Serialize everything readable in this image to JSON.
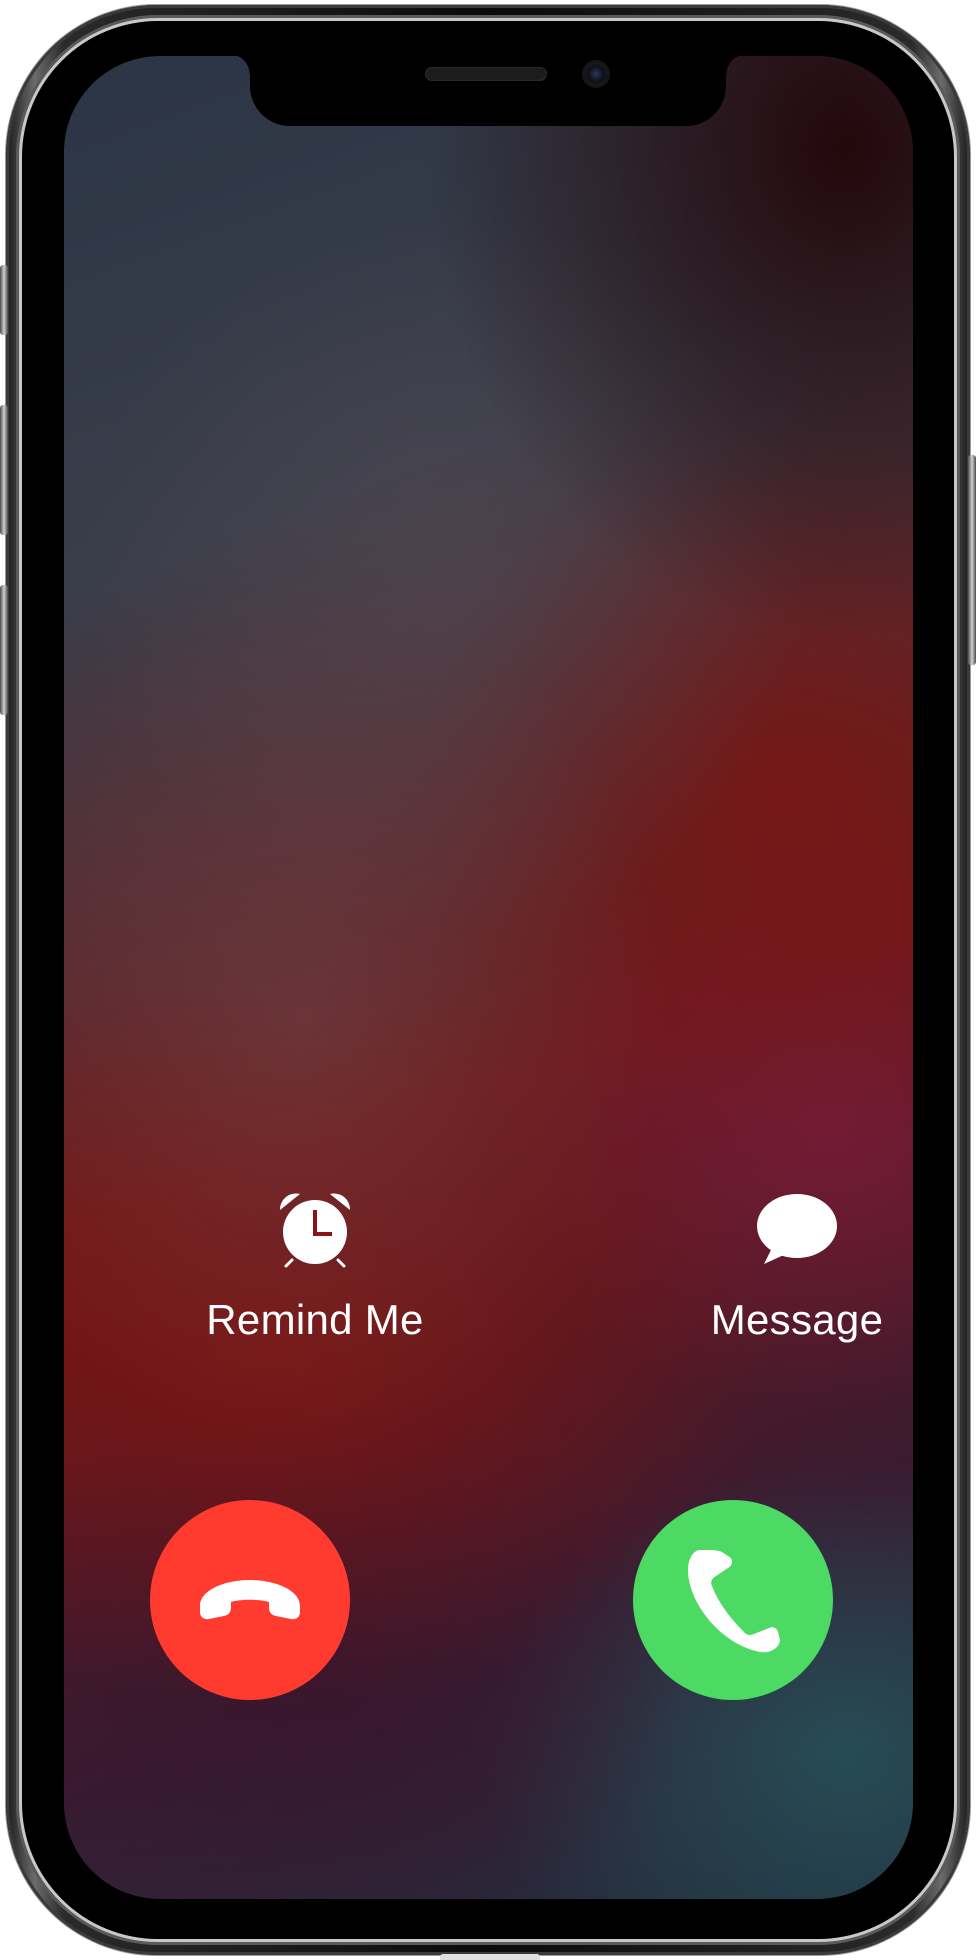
{
  "device": "iPhone",
  "colors": {
    "decline": "#ff3b30",
    "accept": "#4cd964",
    "text": "#ffffff"
  },
  "actions": {
    "remind": {
      "label": "Remind Me",
      "icon": "alarm-clock-icon"
    },
    "message": {
      "label": "Message",
      "icon": "speech-bubble-icon"
    }
  },
  "call_buttons": {
    "decline": {
      "icon": "phone-hangup-icon"
    },
    "accept": {
      "icon": "phone-icon"
    }
  }
}
